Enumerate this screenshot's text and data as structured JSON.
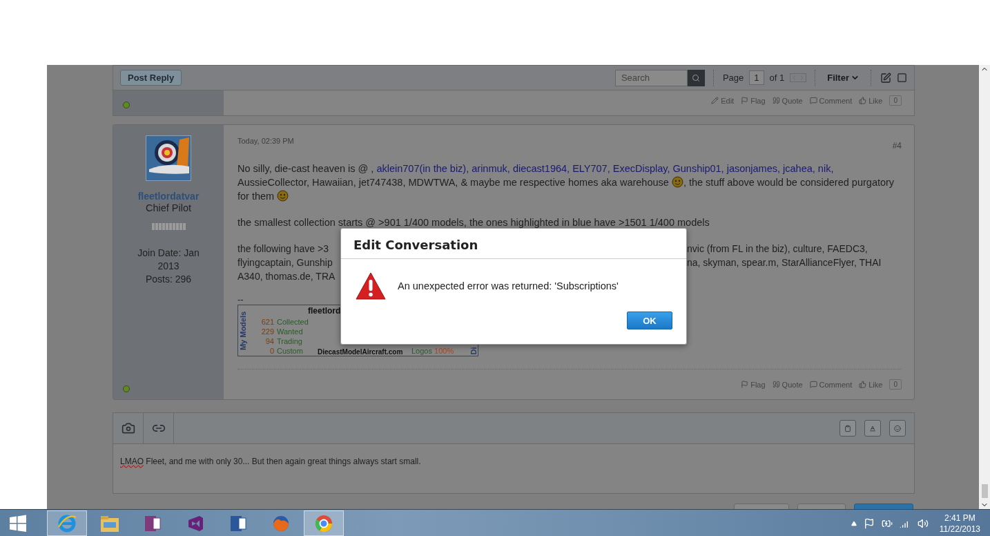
{
  "topbar": {
    "post_reply": "Post Reply",
    "search": {
      "placeholder": "Search"
    },
    "page_label": "Page",
    "page_value": "1",
    "page_total": "of 1",
    "filter": "Filter"
  },
  "previous_post": {
    "online": true,
    "actions": [
      {
        "kind": "edit",
        "label": "Edit"
      },
      {
        "kind": "flag",
        "label": "Flag"
      },
      {
        "kind": "quote",
        "label": "Quote"
      },
      {
        "kind": "comment",
        "label": "Comment"
      },
      {
        "kind": "like",
        "label": "Like"
      }
    ],
    "likes": "0"
  },
  "post": {
    "date": "Today, 02:39 PM",
    "number": "#4",
    "author": {
      "name": "fleetlordatvar",
      "title": "Chief Pilot",
      "join_date": "Join Date: Jan 2013",
      "posts": "Posts: 296",
      "online": true
    },
    "paragraphs": [
      [
        {
          "kind": "text",
          "text": "No silly, die-cast heaven is @ , "
        },
        {
          "kind": "link",
          "text": "aklein707(in the biz), arinmuk, diecast1964, ELY707, ExecDisplay, Gunship01, jasonjames, jcahea, nik,"
        },
        {
          "kind": "break"
        },
        {
          "kind": "text",
          "text": "AussieCollector, Hawaiian, jet747438, MDWTWA, & maybe me respective homes aka warehouse "
        },
        {
          "kind": "emoji"
        },
        {
          "kind": "text",
          "text": ", the stuff above would be considered purgatory for them "
        },
        {
          "kind": "emoji"
        }
      ],
      [
        {
          "kind": "text",
          "text": "the smallest collection starts @ >901 1/400 models, the ones highlighted in blue have >1501 1/400 models"
        }
      ]
    ],
    "obscured_paragraph": [
      {
        "left": "the following have >3",
        "right": "nvic (from FL in the biz), culture, FAEDC3,"
      },
      {
        "left": "flyingcaptain, Gunship",
        "right": "na, skyman, spear.m, StarAllianceFlyer, THAI"
      },
      {
        "left": "A340, thomas.de, TRA"
      }
    ],
    "separator": "--",
    "signature": {
      "title": "fleetlord",
      "side_label": "My Models",
      "stats": [
        {
          "count": "621",
          "label": "Collected"
        },
        {
          "count": "229",
          "label": "Wanted"
        },
        {
          "count": "94",
          "label": "Trading"
        },
        {
          "count": "0",
          "label": "Custom"
        }
      ],
      "site": "DiecastModelAircraft.com",
      "logos_label": "Logos",
      "logos_value": "100%",
      "edge_label": "Di"
    },
    "actions": [
      {
        "kind": "flag",
        "label": "Flag"
      },
      {
        "kind": "quote",
        "label": "Quote"
      },
      {
        "kind": "comment",
        "label": "Comment"
      },
      {
        "kind": "like",
        "label": "Like"
      }
    ],
    "likes": "0"
  },
  "editor": {
    "tools_left": [
      {
        "kind": "camera"
      },
      {
        "kind": "link"
      }
    ],
    "tools_right": [
      {
        "kind": "clipboard"
      },
      {
        "kind": "text-color"
      },
      {
        "kind": "smiley"
      }
    ],
    "value": [
      {
        "text": "LMAO",
        "misspelled": true
      },
      {
        "text": " Fleet, and me with only 30... But then again great things always start small.",
        "misspelled": false
      }
    ]
  },
  "dialog": {
    "title": "Edit Conversation",
    "message": "An unexpected error was returned: 'Subscriptions'",
    "button": "OK"
  },
  "taskbar": {
    "apps": [
      {
        "kind": "ie",
        "selected": true
      },
      {
        "kind": "explorer",
        "selected": false
      },
      {
        "kind": "onenote",
        "selected": false
      },
      {
        "kind": "vs",
        "selected": false
      },
      {
        "kind": "word",
        "selected": false
      },
      {
        "kind": "firefox",
        "selected": false
      },
      {
        "kind": "chrome",
        "selected": true
      }
    ],
    "time": "2:41 PM",
    "date": "11/22/2013"
  }
}
